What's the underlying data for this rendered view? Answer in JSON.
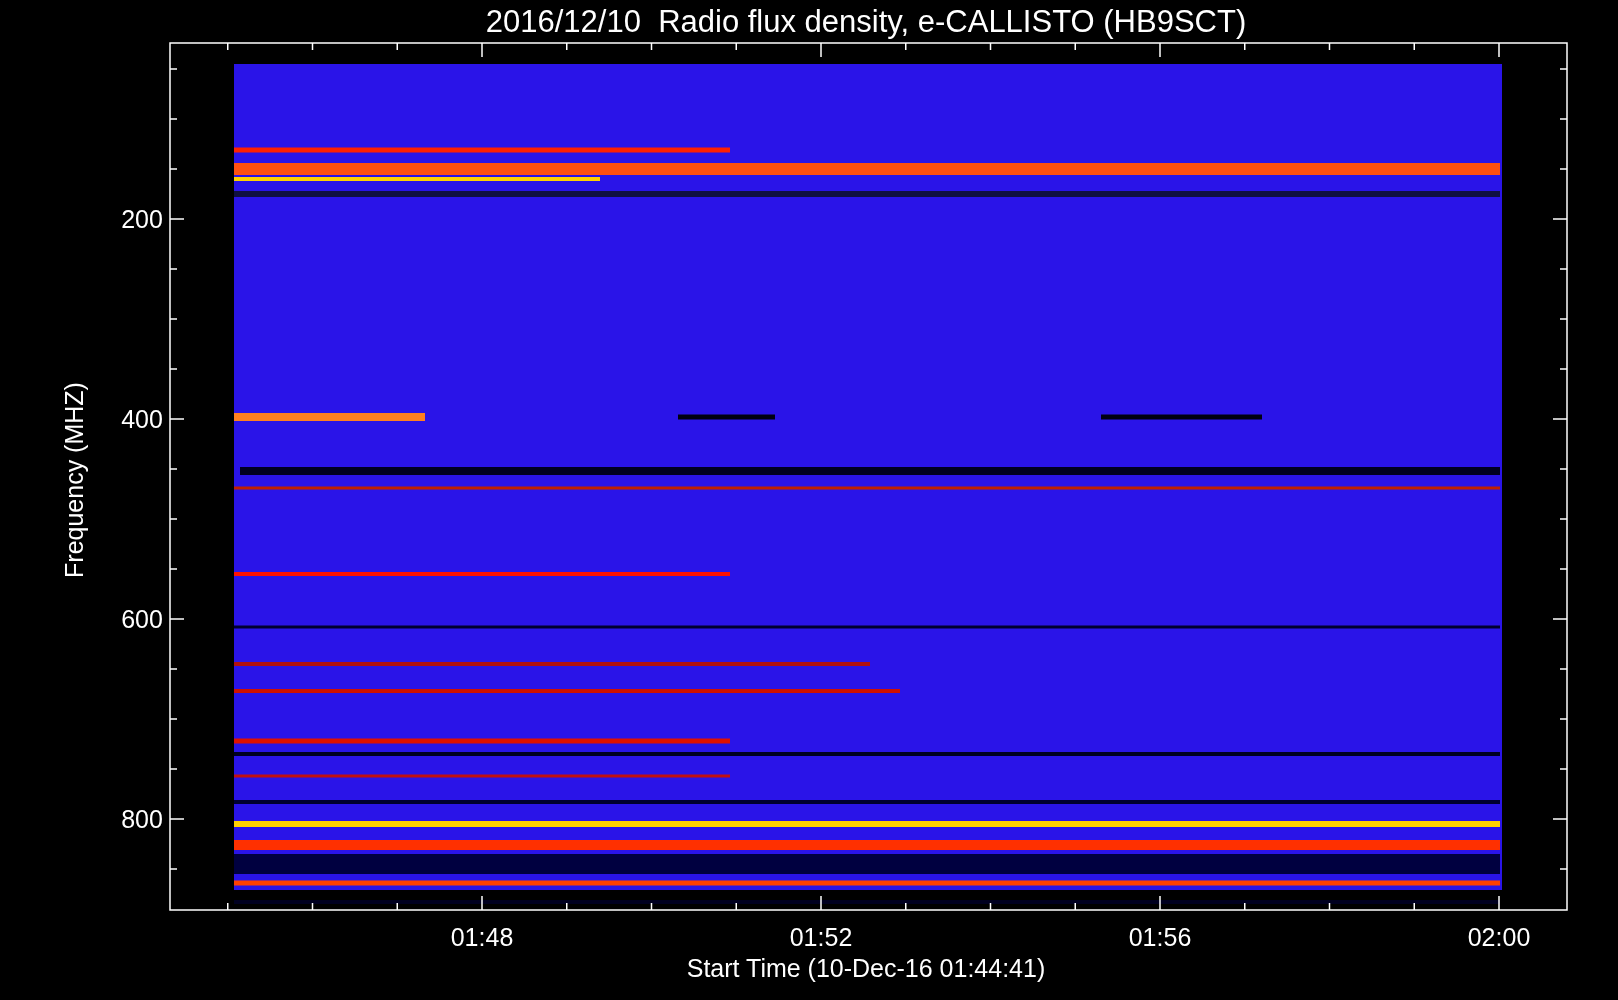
{
  "title": "2016/12/10  Radio flux density, e-CALLISTO (HB9SCT)",
  "y_axis": {
    "label": "Frequency (MHZ)",
    "ticks": [
      "200",
      "400",
      "600",
      "800"
    ]
  },
  "x_axis": {
    "label": "Start Time (10-Dec-16 01:44:41)",
    "ticks": [
      "01:48",
      "01:52",
      "01:56",
      "02:00"
    ]
  }
}
